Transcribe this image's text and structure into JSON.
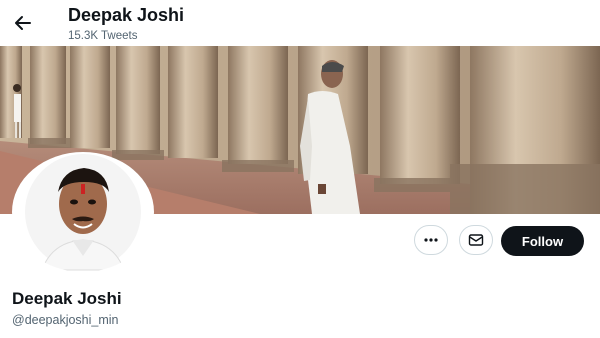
{
  "header": {
    "title": "Deepak Joshi",
    "tweet_count": "15.3K Tweets",
    "back_icon": "arrow-left-icon"
  },
  "profile": {
    "display_name": "Deepak Joshi",
    "handle": "@deepakjoshi_min"
  },
  "actions": {
    "more_icon": "ellipsis-icon",
    "message_icon": "envelope-icon",
    "follow_label": "Follow"
  },
  "colors": {
    "text_primary": "#0f1419",
    "text_secondary": "#536471",
    "button_dark": "#0f1419",
    "border": "#cfd9de"
  }
}
